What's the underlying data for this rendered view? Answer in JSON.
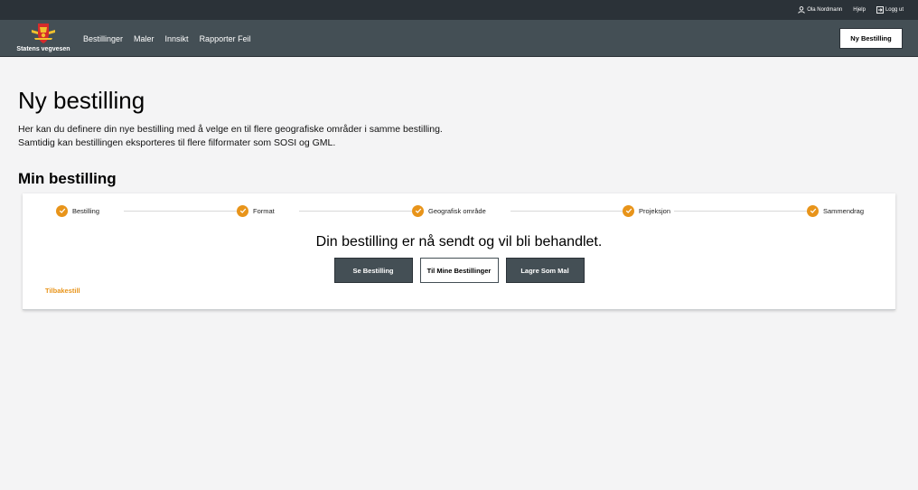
{
  "header": {
    "user_name": "Ola Nordmann",
    "help_label": "Hjelp",
    "logout_label": "Logg ut",
    "brand": "Statens vegvesen",
    "nav": [
      {
        "label": "Bestillinger"
      },
      {
        "label": "Maler"
      },
      {
        "label": "Innsikt"
      },
      {
        "label": "Rapporter Feil"
      }
    ],
    "new_order_button": "Ny Bestilling"
  },
  "main": {
    "title": "Ny bestilling",
    "intro_line1": "Her kan du definere din nye bestilling med å velge en til flere geografiske områder i samme bestilling.",
    "intro_line2": "Samtidig kan bestillingen eksporteres til flere filformater som SOSI og GML.",
    "section_title": "Min bestilling",
    "steps": [
      {
        "label": "Bestilling",
        "done": true
      },
      {
        "label": "Format",
        "done": true
      },
      {
        "label": "Geografisk område",
        "done": true
      },
      {
        "label": "Projeksjon",
        "done": true
      },
      {
        "label": "Sammendrag",
        "done": true
      }
    ],
    "confirmation": "Din bestilling er nå sendt og vil bli behandlet.",
    "buttons": {
      "view": "Se Bestilling",
      "my_orders": "Til Mine Bestillinger",
      "save_template": "Lagre Som Mal"
    },
    "back_link": "Tilbakestill"
  },
  "colors": {
    "accent": "#e8941a",
    "header_dark": "#2b3238",
    "nav_bg": "#444f55",
    "page_bg": "#f4f4f5"
  }
}
